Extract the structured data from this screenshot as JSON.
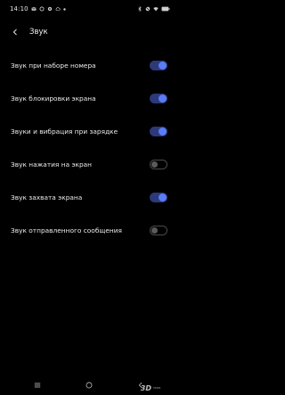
{
  "status_bar": {
    "time": "14:10",
    "left_icons": [
      "mail-icon",
      "sync-icon",
      "settings-icon",
      "cloud-icon",
      "dot-icon"
    ],
    "right_icons": [
      "bluetooth-icon",
      "no-sim-icon",
      "wifi-icon",
      "battery-icon"
    ]
  },
  "header": {
    "title": "Звук",
    "back_icon": "back-arrow-icon"
  },
  "settings": [
    {
      "label": "Звук при наборе номера",
      "enabled": true
    },
    {
      "label": "Звук блокировки экрана",
      "enabled": true
    },
    {
      "label": "Звуки и вибрация при зарядке",
      "enabled": true
    },
    {
      "label": "Звук нажатия на экран",
      "enabled": false
    },
    {
      "label": "Звук захвата экрана",
      "enabled": true
    },
    {
      "label": "Звук отправленного сообщения",
      "enabled": false
    }
  ],
  "nav_bar": {
    "icons": [
      "menu-icon",
      "home-icon",
      "back-icon"
    ]
  },
  "watermark": {
    "logo": "3D",
    "caption": "news"
  },
  "colors": {
    "background": "#000000",
    "accent": "#5b7cf5",
    "toggle_track_on": "#2c3a7a",
    "text": "#ececec"
  }
}
